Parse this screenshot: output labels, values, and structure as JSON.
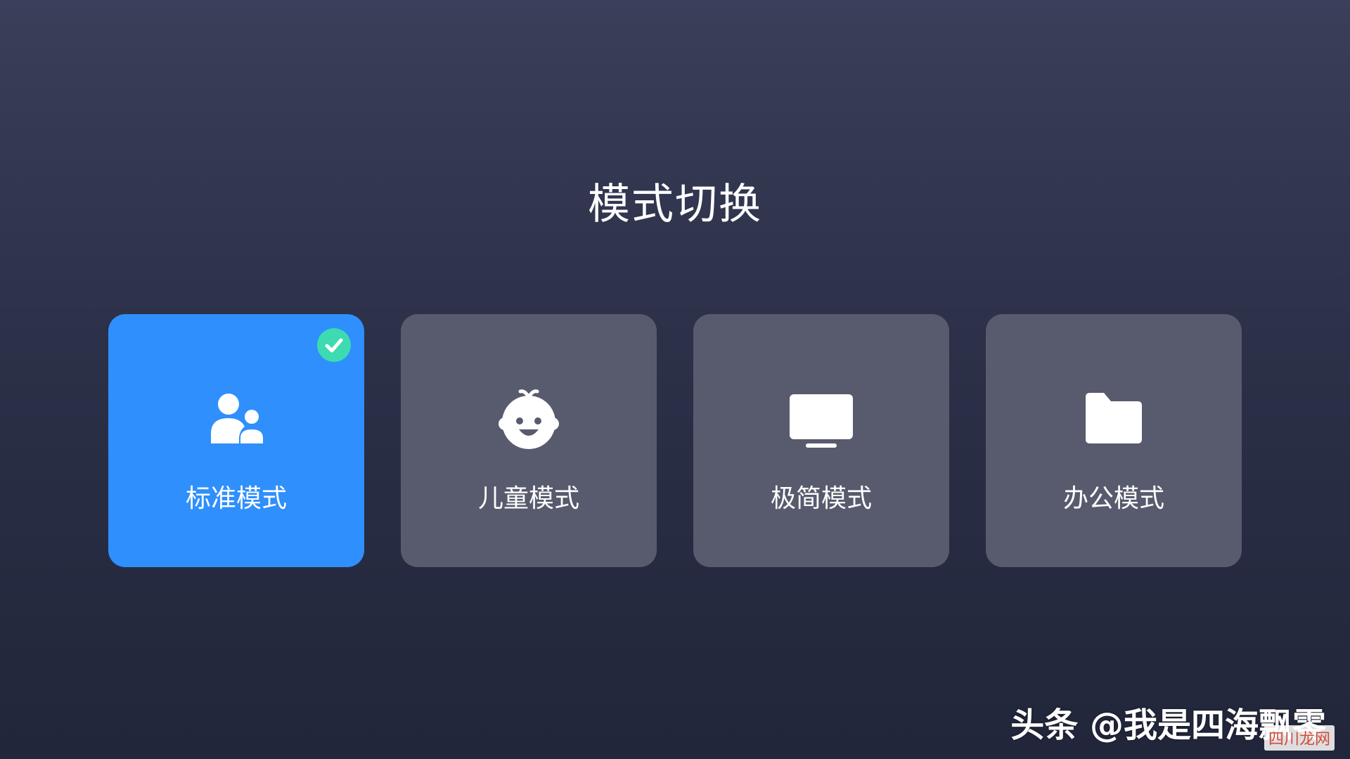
{
  "page": {
    "title": "模式切换"
  },
  "modes": [
    {
      "label": "标准模式",
      "icon": "family-icon",
      "selected": true
    },
    {
      "label": "儿童模式",
      "icon": "baby-face-icon",
      "selected": false
    },
    {
      "label": "极简模式",
      "icon": "tv-icon",
      "selected": false
    },
    {
      "label": "办公模式",
      "icon": "folder-icon",
      "selected": false
    }
  ],
  "colors": {
    "selected_card": "#2f8ffc",
    "card": "#585b6e",
    "check_badge": "#3ddbb0"
  },
  "watermark": {
    "text": "头条 @我是四海飘零",
    "corner_logo": "四川龙网"
  }
}
